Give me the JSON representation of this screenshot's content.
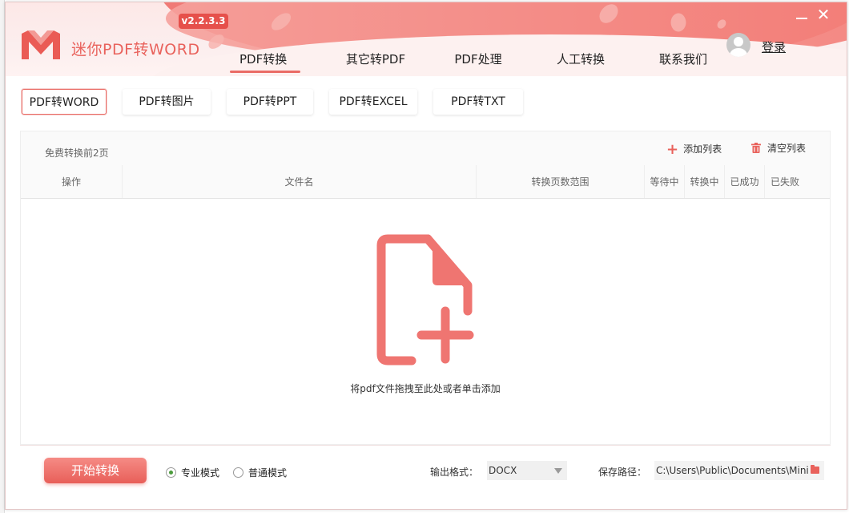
{
  "window": {
    "app_title": "迷你PDF转WORD",
    "version": "v2.2.3.3"
  },
  "nav": {
    "items": [
      {
        "label": "PDF转换",
        "active": true
      },
      {
        "label": "其它转PDF",
        "active": false
      },
      {
        "label": "PDF处理",
        "active": false
      },
      {
        "label": "人工转换",
        "active": false
      },
      {
        "label": "联系我们",
        "active": false
      }
    ]
  },
  "user": {
    "login_label": "登录"
  },
  "subtabs": [
    {
      "label": "PDF转WORD",
      "active": true
    },
    {
      "label": "PDF转图片",
      "active": false
    },
    {
      "label": "PDF转PPT",
      "active": false
    },
    {
      "label": "PDF转EXCEL",
      "active": false
    },
    {
      "label": "PDF转TXT",
      "active": false
    }
  ],
  "panel": {
    "free_note": "免费转换前2页",
    "add_list": "添加列表",
    "clear_list": "清空列表",
    "columns": [
      "操作",
      "文件名",
      "转换页数范围",
      "等待中",
      "转换中",
      "已成功",
      "已失败"
    ],
    "drop_text": "将pdf文件拖拽至此处或者单击添加"
  },
  "bottom": {
    "start_button": "开始转换",
    "mode_pro": "专业模式",
    "mode_normal": "普通模式",
    "format_label": "输出格式：",
    "format_value": "DOCX",
    "path_label": "保存路径：",
    "path_value": "C:\\Users\\Public\\Documents\\Mini"
  },
  "colors": {
    "accent": "#e9625c",
    "header": "#f07a76"
  },
  "icons": [
    "logo-m-icon",
    "avatar-icon",
    "minimize-icon",
    "close-icon",
    "plus-icon",
    "trash-icon",
    "add-document-icon",
    "folder-icon"
  ]
}
